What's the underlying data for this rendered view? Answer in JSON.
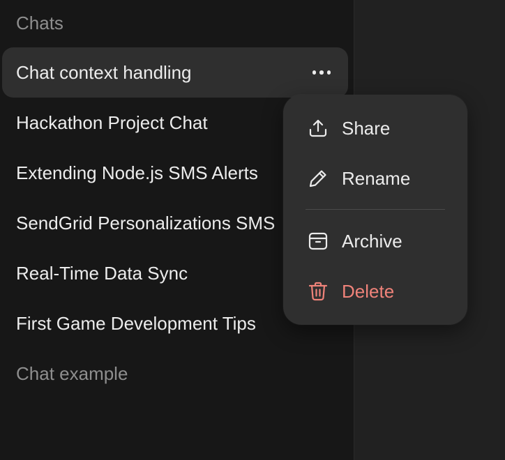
{
  "sidebar": {
    "heading": "Chats",
    "chats": [
      {
        "label": "Chat context handling"
      },
      {
        "label": "Hackathon Project Chat"
      },
      {
        "label": "Extending Node.js SMS Alerts"
      },
      {
        "label": "SendGrid Personalizations SMS"
      },
      {
        "label": "Real-Time Data Sync"
      },
      {
        "label": "First Game Development Tips"
      },
      {
        "label": "Chat example"
      }
    ],
    "active_index": 0,
    "more_button_icon": "ellipsis-icon"
  },
  "context_menu": {
    "items": [
      {
        "label": "Share",
        "icon": "share-icon"
      },
      {
        "label": "Rename",
        "icon": "pencil-icon"
      },
      {
        "label": "Archive",
        "icon": "archive-icon"
      },
      {
        "label": "Delete",
        "icon": "trash-icon"
      }
    ]
  },
  "colors": {
    "sidebar_bg": "#171717",
    "main_bg": "#212121",
    "active_item_bg": "#2f2f2f",
    "menu_bg": "#2f2f2f",
    "text_primary": "#ececec",
    "text_muted": "#8e8e8e",
    "danger": "#f0837a"
  }
}
